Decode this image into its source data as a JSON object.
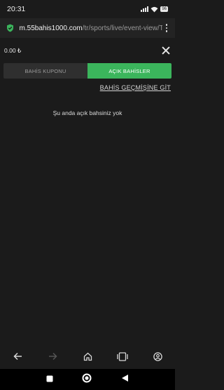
{
  "status_bar": {
    "time": "20:31",
    "battery": "96"
  },
  "browser": {
    "url_host": "m.55bahis1000.com",
    "url_path": "/tr/sports/live/event-view/T€"
  },
  "betslip": {
    "balance": "0.00 ₺",
    "tabs": [
      {
        "label": "BAHİS KUPONU",
        "active": false
      },
      {
        "label": "AÇIK BAHİSLER",
        "active": true
      }
    ],
    "history_link": "BAHİS GEÇMİŞİNE GİT",
    "empty_message": "Şu anda açık bahsiniz yok"
  },
  "colors": {
    "accent": "#3bb55c",
    "background": "#1b1b1b",
    "tab_inactive": "#2f2f2f"
  },
  "icons": {
    "status": [
      "signal-icon",
      "wifi-icon",
      "battery-icon"
    ],
    "browser_nav": [
      "back-icon",
      "forward-icon",
      "home-icon",
      "tabs-icon",
      "account-icon"
    ],
    "system_nav": [
      "recents-icon",
      "home-circle-icon",
      "back-triangle-icon"
    ]
  }
}
